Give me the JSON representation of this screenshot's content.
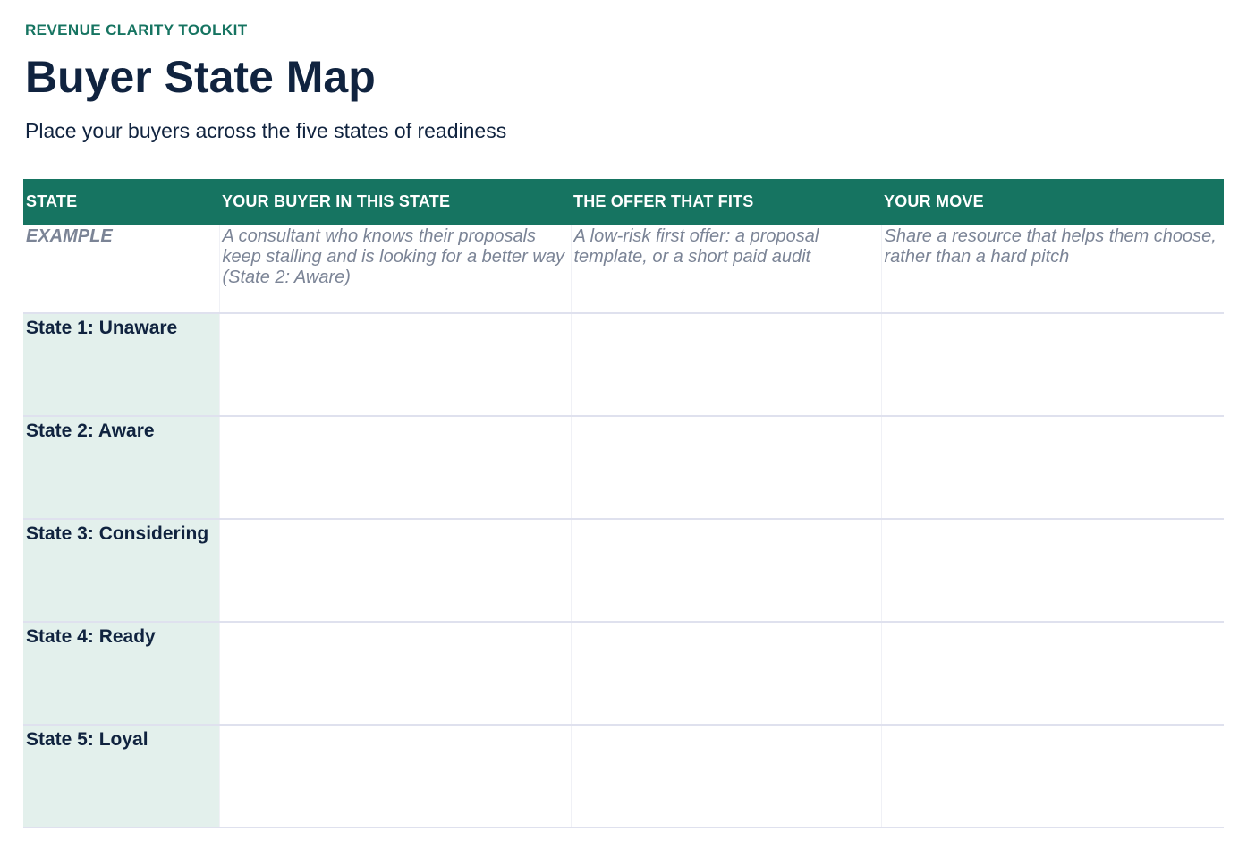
{
  "header": {
    "eyebrow": "REVENUE CLARITY TOOLKIT",
    "title": "Buyer State Map",
    "subtitle": "Place your buyers across the five states of readiness"
  },
  "table": {
    "columns": [
      "STATE",
      "YOUR BUYER IN THIS STATE",
      "THE OFFER THAT FITS",
      "YOUR MOVE"
    ],
    "example": {
      "label": "EXAMPLE",
      "buyer": "A consultant who knows their proposals keep stalling and is looking for a better way (State 2: Aware)",
      "offer": "A low-risk first offer: a proposal template, or a short paid audit",
      "move": "Share a resource that helps them choose, rather than a hard pitch"
    },
    "rows": [
      {
        "state": "State 1: Unaware",
        "buyer": "",
        "offer": "",
        "move": ""
      },
      {
        "state": "State 2: Aware",
        "buyer": "",
        "offer": "",
        "move": ""
      },
      {
        "state": "State 3: Considering",
        "buyer": "",
        "offer": "",
        "move": ""
      },
      {
        "state": "State 4: Ready",
        "buyer": "",
        "offer": "",
        "move": ""
      },
      {
        "state": "State 5: Loyal",
        "buyer": "",
        "offer": "",
        "move": ""
      }
    ]
  },
  "colors": {
    "accent": "#167461",
    "heading": "#10233f",
    "state_cell_bg": "#e3f0ec",
    "example_text": "#7b8496"
  }
}
